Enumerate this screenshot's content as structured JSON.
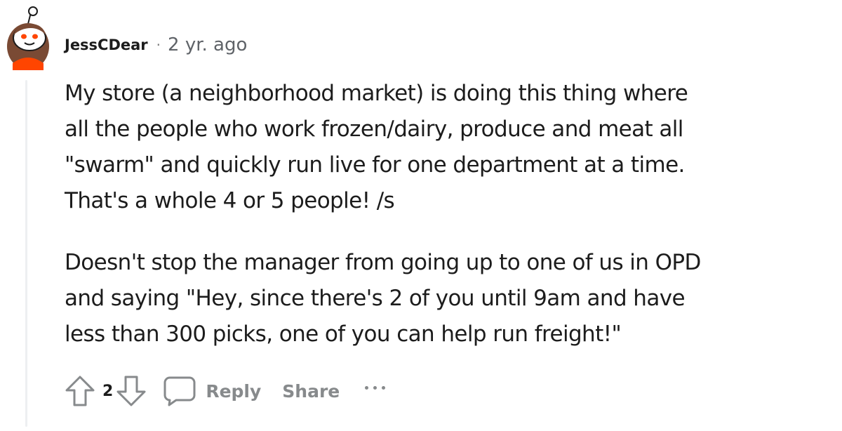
{
  "comment": {
    "author": "JessCDear",
    "separator": "·",
    "timestamp": "2 yr. ago",
    "paragraphs": [
      [
        "My store (a neighborhood market) is doing this thing where",
        "all the people who work frozen/dairy, produce and meat all",
        "\"swarm\" and quickly run live for one department at a time.",
        "That's a whole 4 or 5 people! /s"
      ],
      [
        "Doesn't stop the manager from going up to one of us in OPD",
        "and saying \"Hey, since there's 2 of you until 9am and have",
        "less than 300 picks, one of you can help run freight!\""
      ]
    ]
  },
  "actions": {
    "score": "2",
    "reply_label": "Reply",
    "share_label": "Share",
    "upvote_icon": "upvote-arrow-icon",
    "downvote_icon": "downvote-arrow-icon",
    "reply_icon": "speech-bubble-icon",
    "more_icon": "ellipsis-icon"
  },
  "colors": {
    "text": "#1c1c1c",
    "meta": "#5f6368",
    "action": "#878a8c",
    "thread_line": "#edeff1",
    "avatar_accent": "#ff4500",
    "avatar_hair": "#7a4a34"
  }
}
